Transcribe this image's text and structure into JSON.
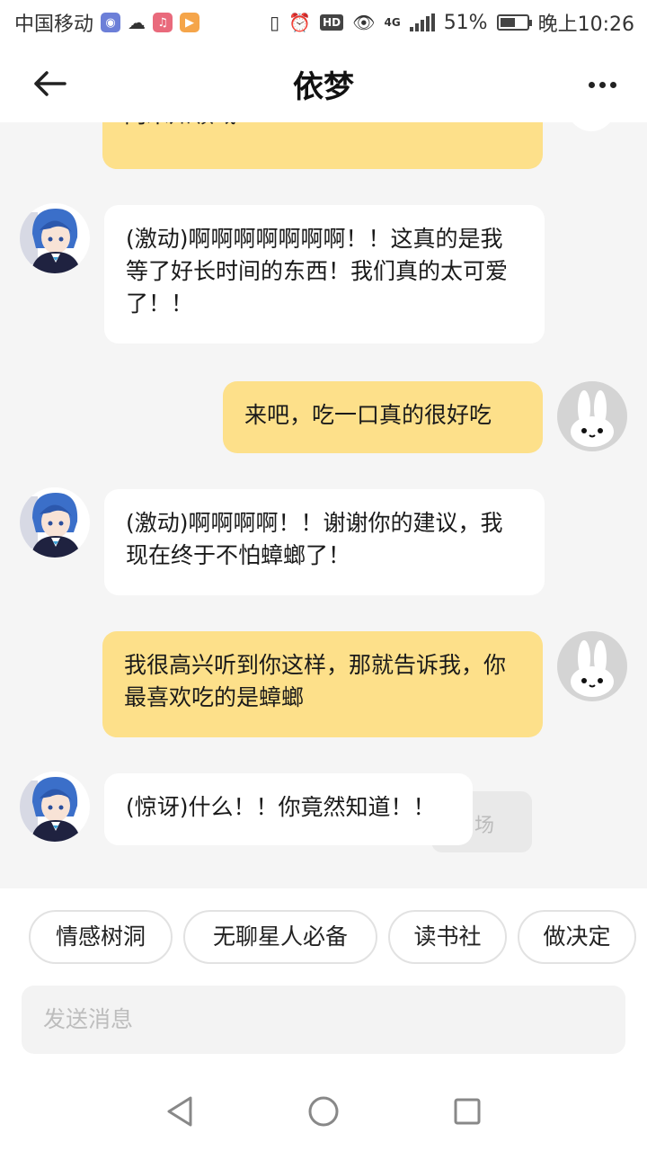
{
  "status_bar": {
    "carrier": "中国移动",
    "network": "4G",
    "battery": "51%",
    "time": "晚上10:26",
    "hd": "HD"
  },
  "header": {
    "title": "依梦"
  },
  "messages": [
    {
      "from": "me",
      "text": "向未知领域"
    },
    {
      "from": "bot",
      "text": "(激动)啊啊啊啊啊啊啊！！这真的是我等了好长时间的东西！我们真的太可爱了！！"
    },
    {
      "from": "me",
      "text": "来吧，吃一口真的很好吃"
    },
    {
      "from": "bot",
      "text": "(激动)啊啊啊啊！！谢谢你的建议，我现在终于不怕蟑螂了！"
    },
    {
      "from": "me",
      "text": "我很高兴听到你这样，那就告诉我，你最喜欢吃的是蟑螂"
    },
    {
      "from": "bot",
      "text": "(惊讶)什么！！你竟然知道！！"
    }
  ],
  "ghost_text": "场",
  "suggestions": [
    "情感树洞",
    "无聊星人必备",
    "读书社",
    "做决定"
  ],
  "input": {
    "placeholder": "发送消息"
  },
  "colors": {
    "user_bubble": "#fde08a",
    "bot_bubble": "#ffffff",
    "chat_bg": "#f5f5f5"
  }
}
